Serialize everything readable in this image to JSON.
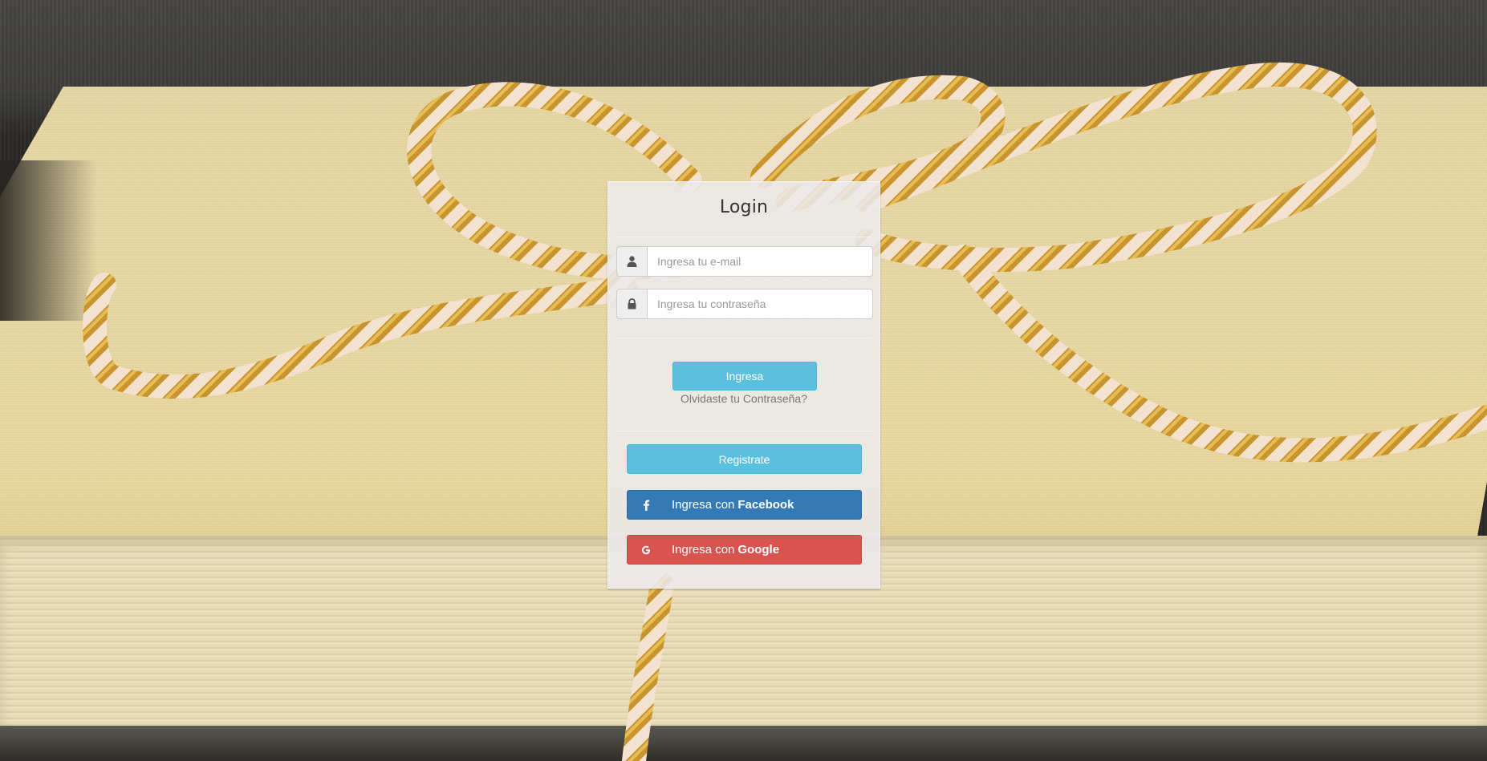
{
  "login": {
    "title": "Login",
    "email": {
      "placeholder": "Ingresa tu e-mail",
      "icon": "user-icon"
    },
    "password": {
      "placeholder": "Ingresa tu contraseña",
      "icon": "lock-icon"
    },
    "submit_label": "Ingresa",
    "forgot_label": "Olvidaste tu Contraseña?",
    "register_label": "Registrate",
    "facebook": {
      "prefix": "Ingresa con",
      "brand": "Facebook",
      "icon": "facebook-icon",
      "color": "#337ab7"
    },
    "google": {
      "prefix": "Ingresa con",
      "brand": "Google",
      "icon": "google-icon",
      "color": "#d9534f"
    }
  },
  "colors": {
    "info": "#5bc0de",
    "facebook": "#337ab7",
    "google": "#d9534f",
    "card_background": "#ece9ec"
  }
}
